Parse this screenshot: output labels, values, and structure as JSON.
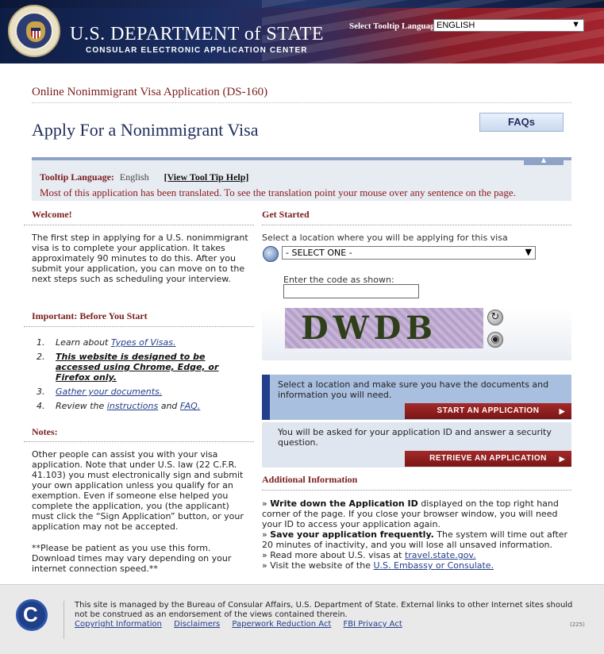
{
  "header": {
    "dept_title": "U.S. DEPARTMENT of STATE",
    "dept_subtitle": "CONSULAR ELECTRONIC APPLICATION CENTER",
    "tooltip_lang_label": "Select Tooltip Language",
    "tooltip_lang_value": "ENGLISH"
  },
  "page": {
    "app_title": "Online Nonimmigrant Visa Application (DS-160)",
    "title": "Apply For a Nonimmigrant Visa",
    "faqs_label": "FAQs"
  },
  "tooltip": {
    "label": "Tooltip Language:",
    "value": "English",
    "help": "[View Tool Tip Help]",
    "message": "Most of this application has been translated. To see the translation point your mouse over any sentence on the page."
  },
  "left": {
    "welcome_head": "Welcome!",
    "welcome_text": "The first step in applying for a U.S. nonimmigrant visa is to complete your application. It takes approximately 90 minutes to do this. After you submit your application, you can move on to the next steps such as scheduling your interview.",
    "important_head": "Important: Before You Start",
    "items": [
      {
        "num": "1.",
        "pre": "Learn about ",
        "link": "Types of Visas.",
        "post": ""
      },
      {
        "num": "2.",
        "pre": "",
        "link": "This website is designed to be accessed using Chrome, Edge, or Firefox only.",
        "post": ""
      },
      {
        "num": "3.",
        "pre": "",
        "link": "Gather your documents.",
        "post": ""
      },
      {
        "num": "4.",
        "pre": "Review the ",
        "link": "instructions",
        "mid": " and ",
        "link2": "FAQ."
      }
    ],
    "notes_head": "Notes:",
    "notes_text": "Other people can assist you with your visa application. Note that under U.S. law (22 C.F.R. 41.103) you must electronically sign and submit your own application unless you qualify for an exemption. Even if someone else helped you complete the application, you (the applicant) must click the “Sign Application” button, or your application may not be accepted.",
    "patience_text": "**Please be patient as you use this form. Download times may vary depending on your internet connection speed.**"
  },
  "right": {
    "get_started_head": "Get Started",
    "select_loc_label": "Select a location where you will be applying for this visa",
    "loc_select_value": "- SELECT ONE -",
    "code_label": "Enter the code as shown:",
    "code_value": "",
    "captcha_text": "DWDB",
    "step1_text": "Select a location and make sure you have the documents and information you will need.",
    "start_btn": "START AN APPLICATION",
    "step2_text": "You will be asked for your application ID and answer a security question.",
    "retrieve_btn": "RETRIEVE AN APPLICATION",
    "additional_head": "Additional Information",
    "info": [
      {
        "bold": "Write down the Application ID",
        "text": " displayed on the top right hand corner of the page. If you close your browser window, you will need your ID to access your application again."
      },
      {
        "bold": "Save your application frequently.",
        "text": " The system will time out after 20 minutes of inactivity, and you will lose all unsaved information."
      },
      {
        "bold": "",
        "text": "Read more about U.S. visas at ",
        "link": "travel.state.gov."
      },
      {
        "bold": "",
        "text": "Visit the website of the ",
        "link": "U.S. Embassy or Consulate."
      }
    ]
  },
  "footer": {
    "text": "This site is managed by the Bureau of Consular Affairs, U.S. Department of State. External links to other Internet sites should not be construed as an endorsement of the views contained therein.",
    "links": [
      "Copyright Information",
      "Disclaimers",
      "Paperwork Reduction Act",
      "FBI Privacy Act"
    ],
    "code": "(225)"
  }
}
